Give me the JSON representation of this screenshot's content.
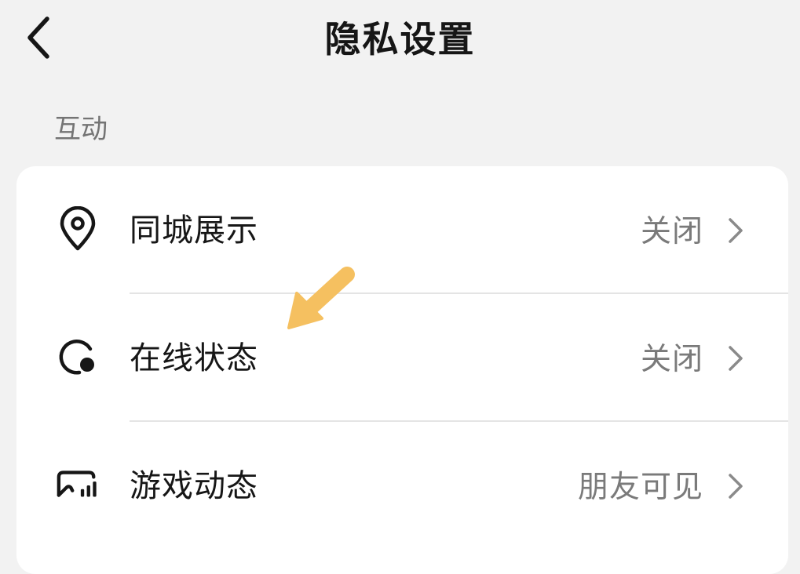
{
  "header": {
    "title": "隐私设置"
  },
  "section": {
    "label": "互动"
  },
  "settings": [
    {
      "icon": "location-pin-icon",
      "label": "同城展示",
      "value": "关闭"
    },
    {
      "icon": "online-status-icon",
      "label": "在线状态",
      "value": "关闭"
    },
    {
      "icon": "game-activity-icon",
      "label": "游戏动态",
      "value": "朋友可见"
    }
  ],
  "colors": {
    "background": "#f2f2f2",
    "card": "#ffffff",
    "title_text": "#161616",
    "secondary_text": "#7a7a7a",
    "annotation_arrow": "#f5c060"
  }
}
